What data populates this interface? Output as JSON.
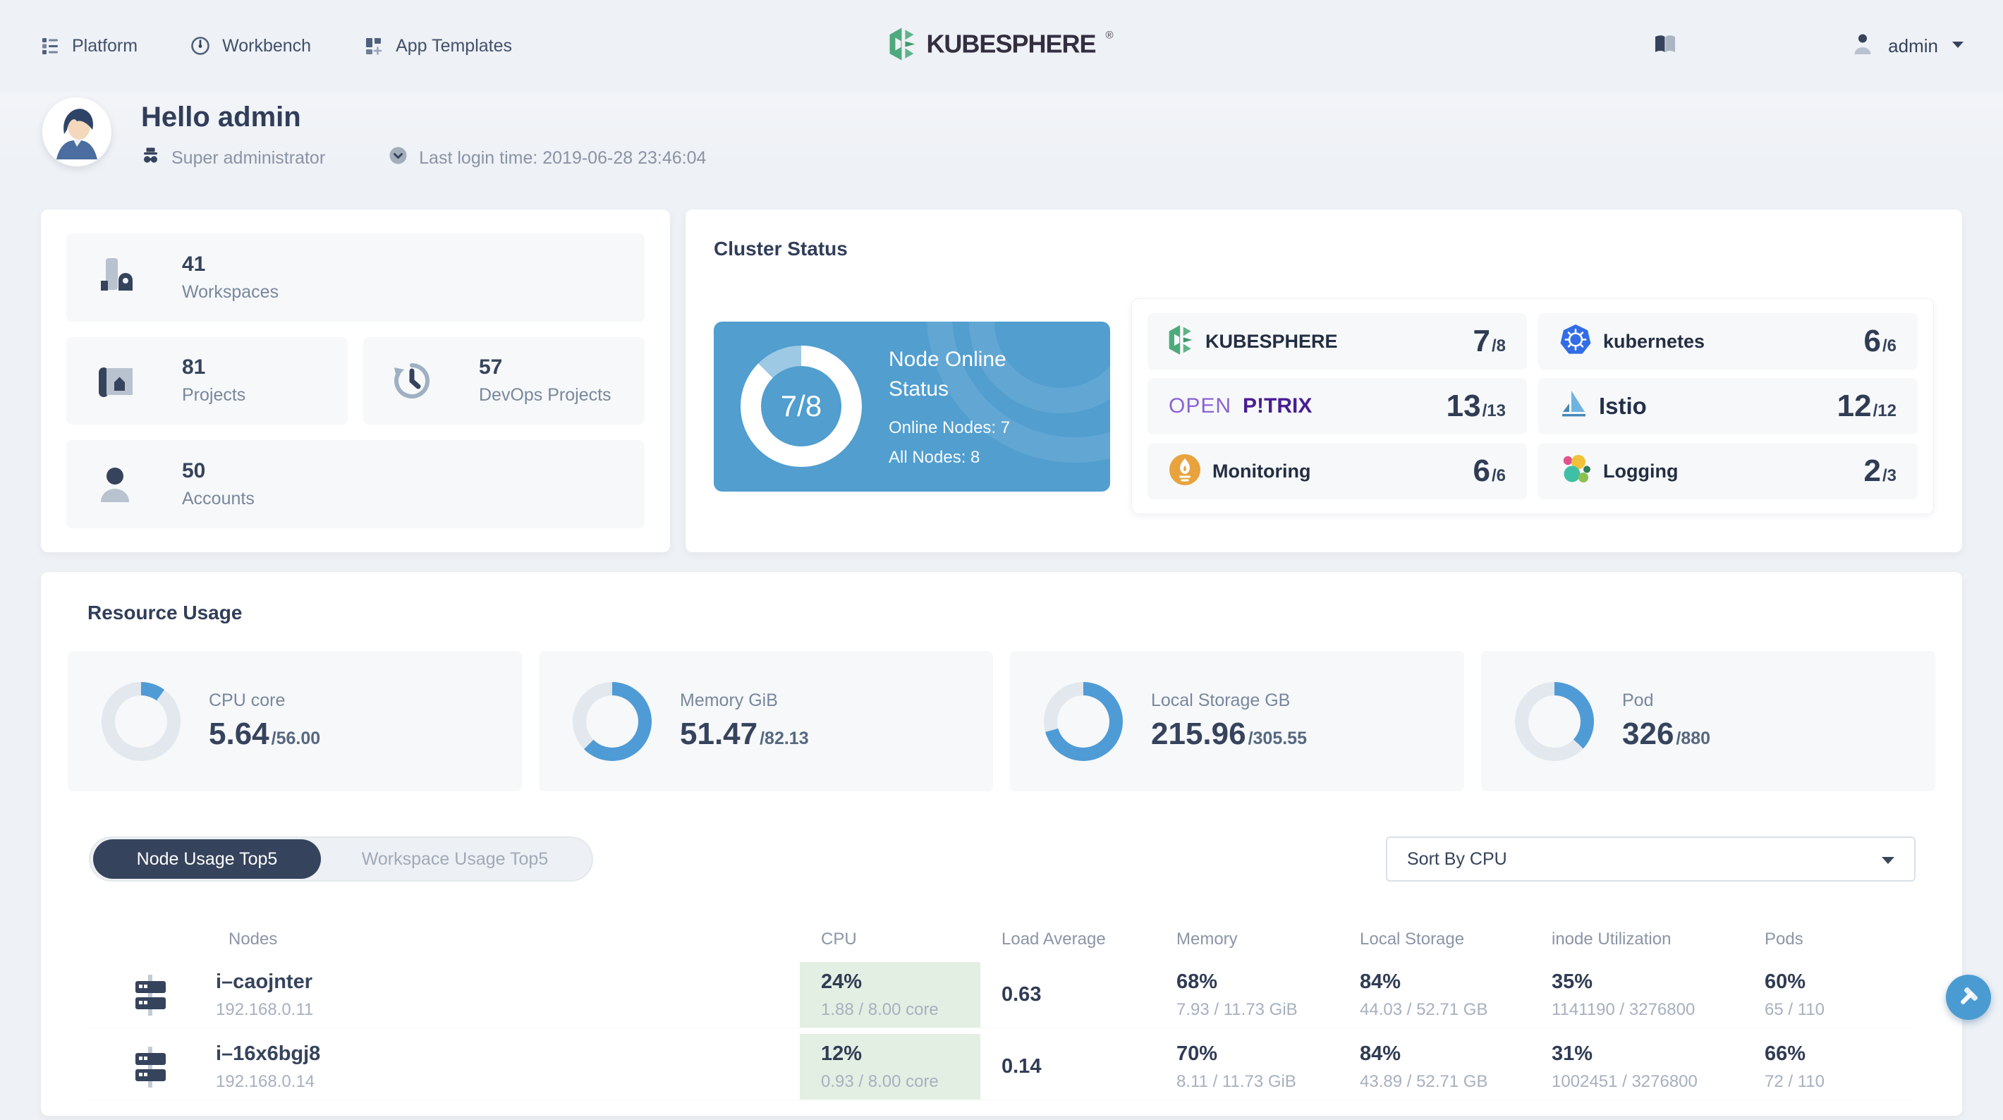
{
  "topbar": {
    "nav": [
      {
        "label": "Platform",
        "icon": "platform-icon"
      },
      {
        "label": "Workbench",
        "icon": "workbench-icon"
      },
      {
        "label": "App Templates",
        "icon": "app-templates-icon"
      }
    ],
    "logo_text": "KUBESPHERE",
    "logo_reg": "®",
    "docs_icon": "book-icon",
    "user": {
      "name": "admin",
      "icon": "user-icon",
      "caret": "chevron-down-icon"
    }
  },
  "greeting": {
    "title": "Hello admin",
    "role": "Super administrator",
    "last_login": "Last login time: 2019-06-28 23:46:04"
  },
  "stats": [
    {
      "value": "41",
      "label": "Workspaces",
      "icon": "workspaces-icon"
    },
    {
      "value": "81",
      "label": "Projects",
      "icon": "projects-icon"
    },
    {
      "value": "57",
      "label": "DevOps Projects",
      "icon": "devops-icon"
    },
    {
      "value": "50",
      "label": "Accounts",
      "icon": "accounts-icon"
    }
  ],
  "cluster_status": {
    "title": "Cluster Status",
    "node_online": {
      "ratio": "7/8",
      "percent": 87.5,
      "title": "Node Online Status",
      "online": "Online Nodes: 7",
      "all": "All Nodes: 8"
    },
    "services": [
      {
        "name": "KUBESPHERE",
        "count": "7",
        "total": "/8",
        "icon": "kubesphere-icon"
      },
      {
        "name": "kubernetes",
        "count": "6",
        "total": "/6",
        "icon": "kubernetes-icon"
      },
      {
        "name_light": "OPEN",
        "name_bold": "P!TRIX",
        "count": "13",
        "total": "/13",
        "icon": "openpitrix-wordmark"
      },
      {
        "name": "Istio",
        "count": "12",
        "total": "/12",
        "icon": "istio-icon"
      },
      {
        "name": "Monitoring",
        "count": "6",
        "total": "/6",
        "icon": "monitoring-icon"
      },
      {
        "name": "Logging",
        "count": "2",
        "total": "/3",
        "icon": "logging-icon"
      }
    ]
  },
  "resource_usage": {
    "title": "Resource Usage",
    "gauges": [
      {
        "label": "CPU core",
        "used": "5.64",
        "total": "/56.00",
        "percent": 10.1
      },
      {
        "label": "Memory GiB",
        "used": "51.47",
        "total": "/82.13",
        "percent": 62.7
      },
      {
        "label": "Local Storage GB",
        "used": "215.96",
        "total": "/305.55",
        "percent": 70.7
      },
      {
        "label": "Pod",
        "used": "326",
        "total": "/880",
        "percent": 37.0
      }
    ],
    "tabs": [
      {
        "label": "Node Usage Top5",
        "active": true
      },
      {
        "label": "Workspace Usage Top5",
        "active": false
      }
    ],
    "sort_by": "Sort By CPU"
  },
  "node_table": {
    "columns": [
      "Nodes",
      "CPU",
      "Load Average",
      "Memory",
      "Local Storage",
      "inode Utilization",
      "Pods"
    ],
    "rows": [
      {
        "name": "i–caojnter",
        "ip": "192.168.0.11",
        "cpu": {
          "percent": "24%",
          "detail": "1.88 / 8.00 core"
        },
        "load": "0.63",
        "memory": {
          "percent": "68%",
          "detail": "7.93 / 11.73 GiB"
        },
        "storage": {
          "percent": "84%",
          "detail": "44.03 / 52.71 GB"
        },
        "inode": {
          "percent": "35%",
          "detail": "1141190 / 3276800"
        },
        "pods": {
          "percent": "60%",
          "detail": "65 / 110"
        }
      },
      {
        "name": "i–16x6bgj8",
        "ip": "192.168.0.14",
        "cpu": {
          "percent": "12%",
          "detail": "0.93 / 8.00 core"
        },
        "load": "0.14",
        "memory": {
          "percent": "70%",
          "detail": "8.11 / 11.73 GiB"
        },
        "storage": {
          "percent": "84%",
          "detail": "43.89 / 52.71 GB"
        },
        "inode": {
          "percent": "31%",
          "detail": "1002451 / 3276800"
        },
        "pods": {
          "percent": "66%",
          "detail": "72 / 110"
        }
      }
    ]
  },
  "fab": {
    "icon": "hammer-icon"
  },
  "colors": {
    "accent_blue": "#519ECF",
    "brand_green": "#55BC8A",
    "dark_text": "#36435C",
    "muted_text": "#79879C",
    "light_text": "#A7B0BF",
    "cpu_cell_green": "#E4EFE4",
    "tile_gray": "#F6F8FA",
    "page_bg": "#EEF1F5"
  }
}
